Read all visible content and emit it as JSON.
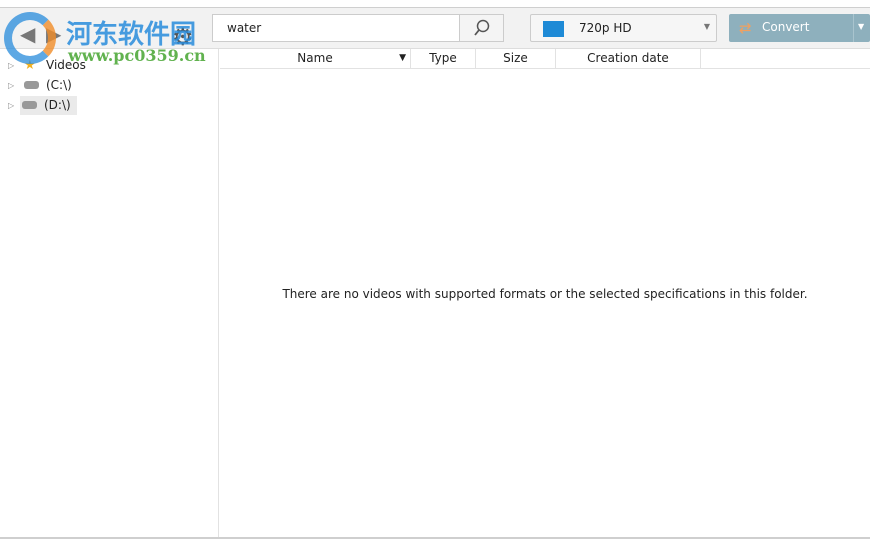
{
  "toolbar": {
    "search_value": "water",
    "format_label": "720p HD",
    "convert_label": "Convert"
  },
  "tree": [
    {
      "label": "Videos",
      "icon": "star-folder-icon"
    },
    {
      "label": "(C:\\)",
      "icon": "drive-icon"
    },
    {
      "label": "(D:\\)",
      "icon": "drive-icon",
      "selected": true
    }
  ],
  "columns": [
    "Name",
    "Type",
    "Size",
    "Creation date"
  ],
  "empty_message": "There are no videos with supported formats or the selected specifications in this folder.",
  "watermark": {
    "site_name": "河东软件园",
    "url": "www.pc0359.cn"
  },
  "colors": {
    "convert": "#8eb0bd",
    "accent": "#1e8ad6"
  }
}
